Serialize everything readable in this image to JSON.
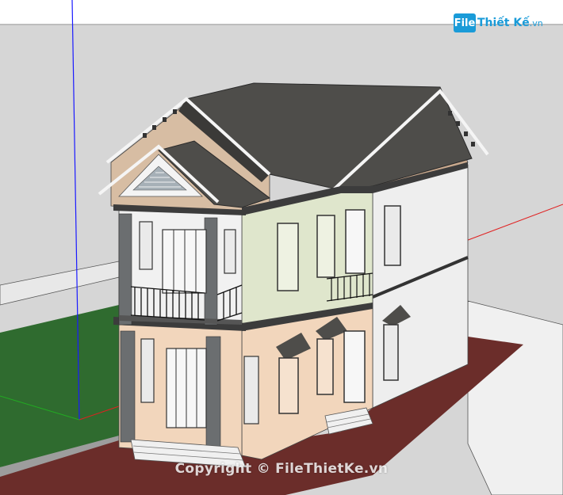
{
  "viewport": {
    "background": "#ffffff"
  },
  "logo": {
    "badge": "File",
    "name": "Thiết Kế",
    "domain": ".vn"
  },
  "watermark": {
    "text": "Copyright © FileThietKe.vn"
  },
  "colors": {
    "roof": "#4e4d4a",
    "gable_top": "#c9a98e",
    "upper_wall_left": "#e8e8e8",
    "upper_wall_mid": "#dfe6cc",
    "lower_wall": "#f2d6bc",
    "side_wall": "#eeeeee",
    "column": "#6b6e70",
    "grass": "#2f6b2f",
    "driveway": "#6b2d2a",
    "axis_blue": "#1a1aff",
    "axis_red": "#e02020",
    "axis_green": "#22aa22"
  }
}
